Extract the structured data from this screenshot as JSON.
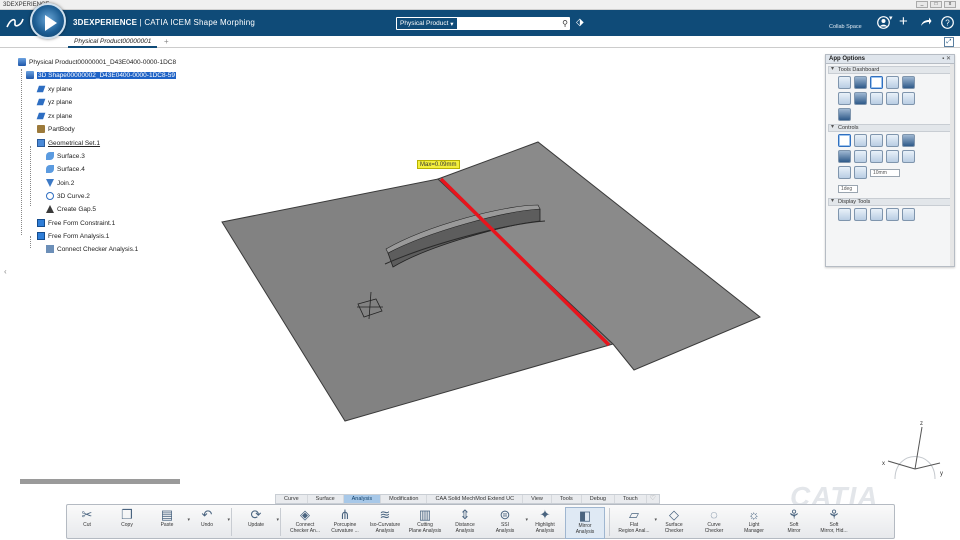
{
  "window": {
    "title": "3DEXPERIENCE",
    "controls": [
      "_",
      "□",
      "x"
    ]
  },
  "header": {
    "brand_bold": "3DEXPERIENCE",
    "brand_rest": "CATIA ICEM Shape Morphing",
    "search_scope": "Physical Product",
    "search_placeholder": "",
    "collab_space": "Collab Space",
    "icons": [
      "ds-logo-icon",
      "compass-icon",
      "search-icon",
      "tag-icon",
      "user-icon",
      "add-icon",
      "share-icon",
      "help-icon"
    ]
  },
  "tabbar": {
    "tab_label": "Physical Product00000001",
    "add_label": "+"
  },
  "tree": {
    "root": "Physical Product00000001_D43E0400-0000-1DC8",
    "shape": "3D Shape00000002_D43E0400-0000-1DC8-59",
    "xy": "xy plane",
    "yz": "yz plane",
    "zx": "zx plane",
    "partbody": "PartBody",
    "geoset": "Geometrical Set.1",
    "surf3": "Surface.3",
    "surf4": "Surface.4",
    "join2": "Join.2",
    "curve2": "3D Curve.2",
    "gap5": "Create Gap.5",
    "ffc1": "Free Form Constraint.1",
    "ffa1": "Free Form Analysis.1",
    "cca1": "Connect Checker Analysis.1"
  },
  "viewport": {
    "max_label": "Max=0.09mm",
    "watermark": "CATIA",
    "progress": 1.0
  },
  "app_options": {
    "title": "App Options",
    "sections": [
      "Tools Dashboard",
      "Controls",
      "Display Tools"
    ],
    "field_distance": "10mm",
    "field_angle": "1deg"
  },
  "section_tabs": [
    "Curve",
    "Surface",
    "Analysis",
    "Modification",
    "CAA Solid MechMod Extend UC",
    "View",
    "Tools",
    "Debug",
    "Touch"
  ],
  "active_tab": "Analysis",
  "commands": {
    "cut": "Cut",
    "copy": "Copy",
    "paste": "Paste",
    "undo": "Undo",
    "update": "Update",
    "connect": "Connect\nChecker An...",
    "porcupine": "Porcupine\nCurvature ...",
    "isocurv": "Iso-Curvature\nAnalysis",
    "cutting": "Cutting\nPlane Analysis",
    "distance": "Distance\nAnalysis",
    "ssi": "SSI\nAnalysis",
    "highlight": "Highlight\nAnalysis",
    "mirror": "Mirror\nAnalysis",
    "flat": "Flat\nRegion Anal...",
    "surfchk": "Surface\nChecker",
    "curvechk": "Curve\nChecker",
    "light": "Light\nManager",
    "softmirror": "Soft\nMirror",
    "softhid": "Soft\nMirror, Hid..."
  },
  "axes": {
    "x": "x",
    "y": "y",
    "z": "z"
  }
}
